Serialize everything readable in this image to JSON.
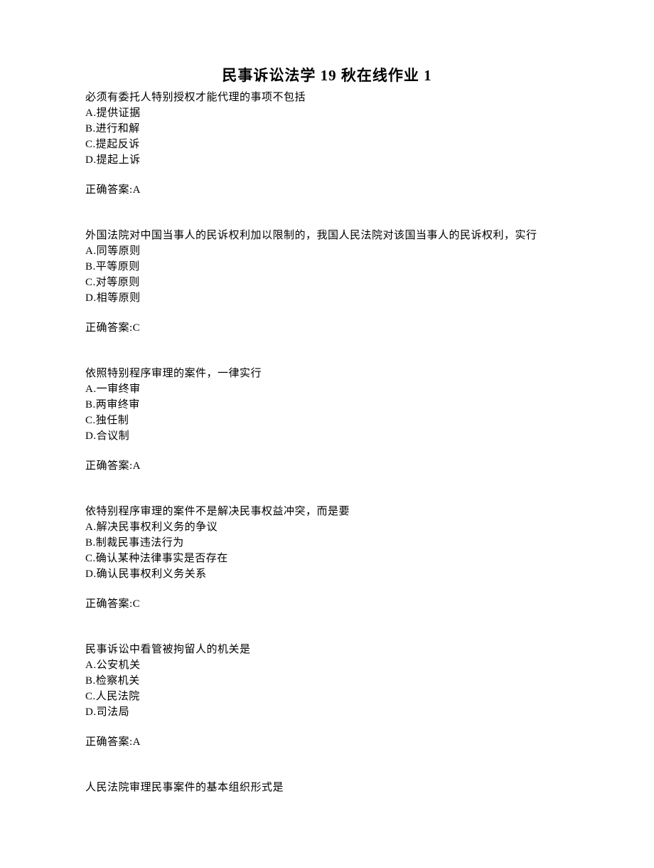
{
  "title": "民事诉讼法学 19 秋在线作业 1",
  "questions": [
    {
      "stem": "必须有委托人特别授权才能代理的事项不包括",
      "choices": [
        "A.提供证据",
        "B.进行和解",
        "C.提起反诉",
        "D.提起上诉"
      ],
      "answer": "正确答案:A"
    },
    {
      "stem": "外国法院对中国当事人的民诉权利加以限制的，我国人民法院对该国当事人的民诉权利，实行",
      "choices": [
        "A.同等原则",
        "B.平等原则",
        "C.对等原则",
        "D.相等原则"
      ],
      "answer": "正确答案:C"
    },
    {
      "stem": "依照特别程序审理的案件，一律实行",
      "choices": [
        "A.一审终审",
        "B.两审终审",
        "C.独任制",
        "D.合议制"
      ],
      "answer": "正确答案:A"
    },
    {
      "stem": "依特别程序审理的案件不是解决民事权益冲突，而是要",
      "choices": [
        "A.解决民事权利义务的争议",
        "B.制裁民事违法行为",
        "C.确认某种法律事实是否存在",
        "D.确认民事权利义务关系"
      ],
      "answer": "正确答案:C"
    },
    {
      "stem": "民事诉讼中看管被拘留人的机关是",
      "choices": [
        "A.公安机关",
        "B.检察机关",
        "C.人民法院",
        "D.司法局"
      ],
      "answer": "正确答案:A"
    },
    {
      "stem": "人民法院审理民事案件的基本组织形式是",
      "choices": [],
      "answer": ""
    }
  ]
}
